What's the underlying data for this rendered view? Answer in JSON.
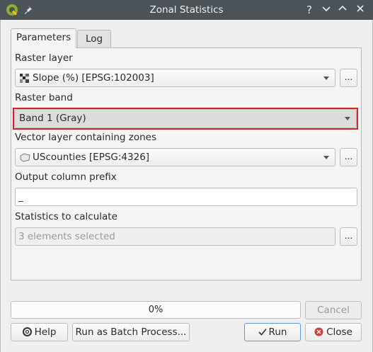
{
  "window": {
    "title": "Zonal Statistics"
  },
  "titlebar": {
    "help": "?",
    "minimize": "⌄",
    "maximize": "⌃",
    "close": "✕"
  },
  "tabs": [
    {
      "label": "Parameters",
      "active": true
    },
    {
      "label": "Log",
      "active": false
    }
  ],
  "fields": {
    "raster_layer": {
      "label": "Raster layer",
      "value": "Slope (%) [EPSG:102003]",
      "browse": "..."
    },
    "raster_band": {
      "label": "Raster band",
      "value": "Band 1 (Gray)"
    },
    "vector_layer": {
      "label": "Vector layer containing zones",
      "value": "UScounties [EPSG:4326]",
      "browse": "..."
    },
    "prefix": {
      "label": "Output column prefix",
      "value": "_"
    },
    "statistics": {
      "label": "Statistics to calculate",
      "placeholder": "3 elements selected",
      "browse": "..."
    }
  },
  "progress": {
    "text": "0%",
    "value": 0
  },
  "buttons": {
    "cancel": "Cancel",
    "help": "Help",
    "batch": "Run as Batch Process...",
    "run": "Run",
    "close": "Close"
  },
  "colors": {
    "highlight": "#d6232b",
    "titlebar": "#4b5358"
  }
}
